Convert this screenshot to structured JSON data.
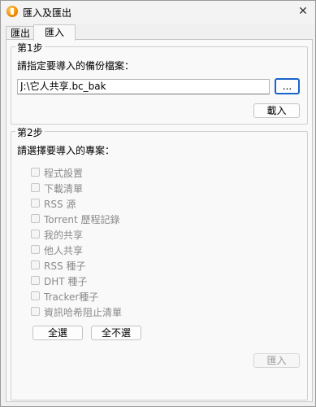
{
  "window": {
    "title": "匯入及匯出",
    "close_glyph": "✕"
  },
  "tabs": [
    {
      "label": "匯出"
    },
    {
      "label": "匯入"
    }
  ],
  "step1": {
    "title": "第1步",
    "instruction": "請指定要導入的備份檔案：",
    "path_value": "J:\\它人共享.bc_bak",
    "browse_label": "...",
    "load_label": "載入"
  },
  "step2": {
    "title": "第2步",
    "instruction": "請選擇要導入的專案：",
    "items": [
      {
        "label": "程式設置",
        "checked": false,
        "enabled": false
      },
      {
        "label": "下載清單",
        "checked": false,
        "enabled": false
      },
      {
        "label": "RSS 源",
        "checked": false,
        "enabled": false
      },
      {
        "label": "Torrent 歷程記錄",
        "checked": false,
        "enabled": false
      },
      {
        "label": "我的共享",
        "checked": false,
        "enabled": false
      },
      {
        "label": "他人共享",
        "checked": false,
        "enabled": false
      },
      {
        "label": "RSS 種子",
        "checked": false,
        "enabled": false
      },
      {
        "label": "DHT 種子",
        "checked": false,
        "enabled": false
      },
      {
        "label": "Tracker種子",
        "checked": false,
        "enabled": false
      },
      {
        "label": "資訊哈希阻止清單",
        "checked": false,
        "enabled": false
      }
    ],
    "select_all_label": "全選",
    "select_none_label": "全不選",
    "import_label": "匯入"
  },
  "colors": {
    "focus_border": "#1a64c8",
    "disabled_text": "#8a8a8a"
  },
  "icons": {
    "app": "bitcomet-app-icon",
    "close": "close-icon"
  }
}
